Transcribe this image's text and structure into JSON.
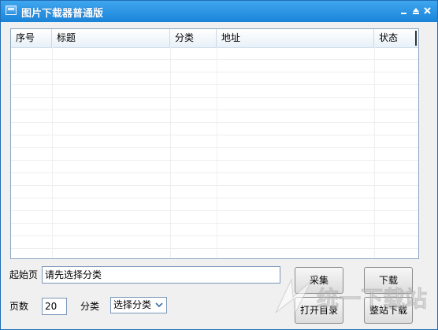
{
  "window": {
    "title": "图片下载器普通版"
  },
  "table": {
    "columns": [
      "序号",
      "标题",
      "分类",
      "地址",
      "状态"
    ]
  },
  "form": {
    "start_page_label": "起始页",
    "start_page_value": "请先选择分类",
    "pages_label": "页数",
    "pages_value": "20",
    "category_label": "分类",
    "category_selected": "选择分类"
  },
  "buttons": {
    "collect": "采集",
    "download": "下载",
    "open_dir": "打开目录",
    "site_download": "整站下载"
  },
  "watermark": {
    "text": "统一下载站"
  },
  "colors": {
    "title_bar": "#1b84d8",
    "grid_border": "#8aa6c3",
    "accent": "#2a8fd8"
  },
  "icons": [
    "app-icon",
    "minimize-icon",
    "maximize-icon",
    "close-icon",
    "chevron-down-icon"
  ]
}
